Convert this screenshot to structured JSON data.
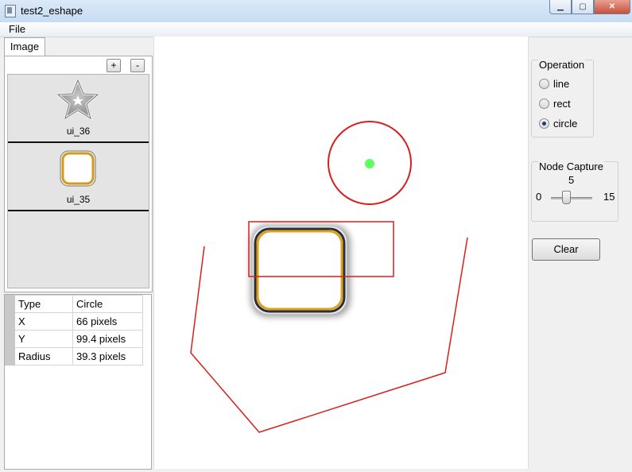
{
  "window": {
    "title": "test2_eshape"
  },
  "menu": {
    "file": "File"
  },
  "left": {
    "tab": "Image",
    "add_label": "+",
    "remove_label": "-",
    "images": [
      {
        "label": "ui_36",
        "icon": "star-icon"
      },
      {
        "label": "ui_35",
        "icon": "rounded-square-icon"
      }
    ],
    "properties": [
      {
        "key": "Type",
        "value": "Circle"
      },
      {
        "key": "X",
        "value": "66 pixels"
      },
      {
        "key": "Y",
        "value": "99.4 pixels"
      },
      {
        "key": "Radius",
        "value": "39.3 pixels"
      }
    ]
  },
  "right": {
    "operation": {
      "title": "Operation",
      "options": [
        "line",
        "rect",
        "circle"
      ],
      "selected": "circle"
    },
    "node_capture": {
      "title": "Node Capture",
      "min": "0",
      "max": "15",
      "value": "5"
    },
    "clear_label": "Clear"
  },
  "colors": {
    "shape_stroke": "#d61f1f",
    "circle_center": "#4cff4c",
    "frame_orange": "#e0a019",
    "frame_dark": "#2a2f3d"
  }
}
